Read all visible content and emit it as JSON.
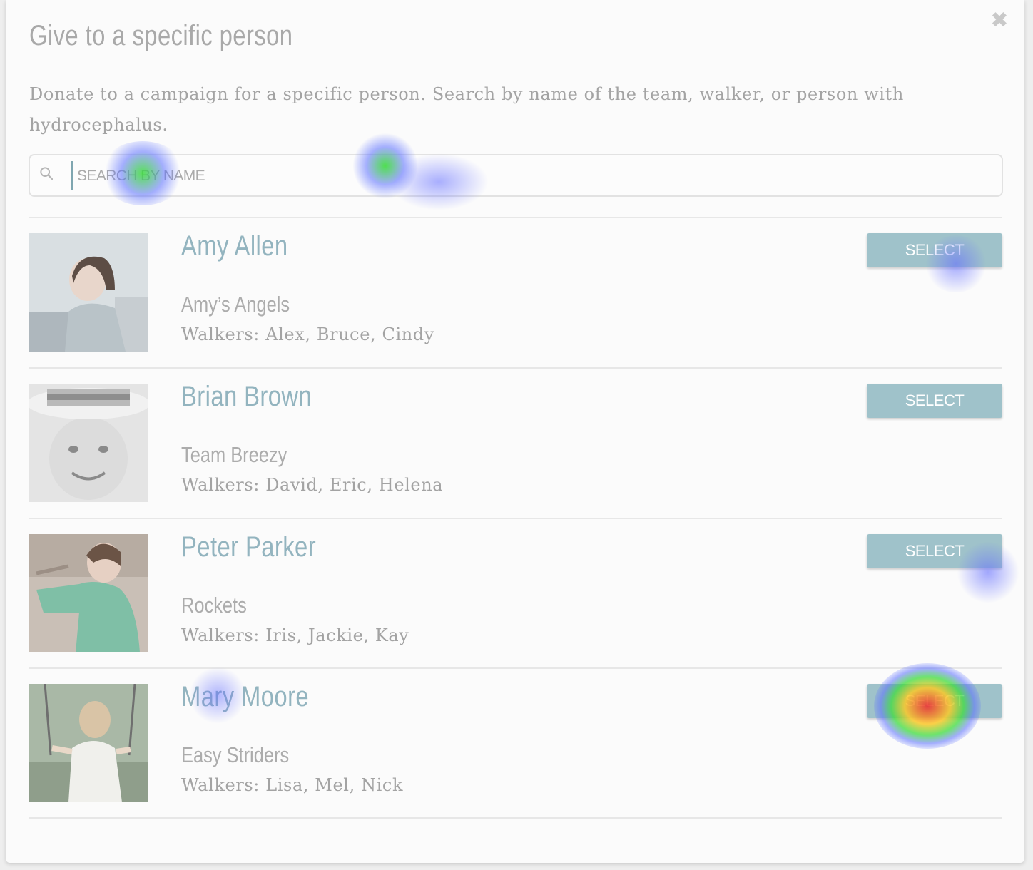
{
  "dialog": {
    "title": "Give to a specific person",
    "description": "Donate to a campaign for a specific person. Search by name of the team, walker, or person with hydrocephalus.",
    "close_icon": "close-icon"
  },
  "search": {
    "placeholder": "SEARCH BY NAME",
    "value": "",
    "icon": "search-icon"
  },
  "people": [
    {
      "name": "Amy Allen",
      "team": "Amy’s Angels",
      "walkers": "Walkers: Alex, Bruce, Cindy",
      "button": "SELECT"
    },
    {
      "name": "Brian Brown",
      "team": "Team Breezy",
      "walkers": "Walkers: David, Eric, Helena",
      "button": "SELECT"
    },
    {
      "name": "Peter Parker",
      "team": "Rockets",
      "walkers": "Walkers: Iris, Jackie, Kay",
      "button": "SELECT"
    },
    {
      "name": "Mary Moore",
      "team": "Easy Striders",
      "walkers": "Walkers: Lisa, Mel, Nick",
      "button": "SELECT"
    }
  ],
  "colors": {
    "accent": "#9fc2ca",
    "name": "#93b4bf",
    "muted_text": "#a3a3a3"
  }
}
